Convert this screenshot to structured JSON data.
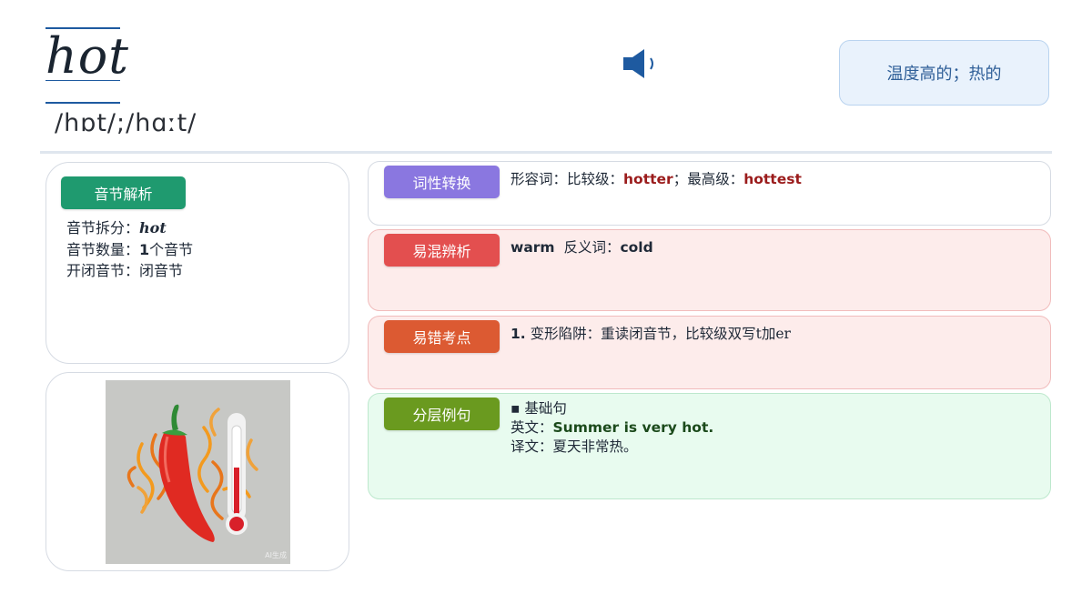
{
  "header": {
    "word": "hot",
    "phonetic": "/hɒt/;/hɑːt/",
    "meaning": "温度高的；热的",
    "speaker_icon": "speaker-icon"
  },
  "syllable": {
    "title": "音节解析",
    "split_label": "音节拆分：",
    "split_value": "hot",
    "count_label": "音节数量：",
    "count_value": "1",
    "count_suffix": "个音节",
    "type_label": "开闭音节：",
    "type_value": "闭音节"
  },
  "illustration": {
    "watermark": "AI生成"
  },
  "pos": {
    "title": "词性转换",
    "adj_label": "形容词：比较级：",
    "comparative": "hotter",
    "sep": "；最高级：",
    "superlative": "hottest"
  },
  "confusion": {
    "title": "易混辨析",
    "word": "warm",
    "antonym_label": "反义词：",
    "antonym": "cold"
  },
  "errors": {
    "title": "易错考点",
    "num": "1.",
    "text": "变形陷阱：重读闭音节，比较级双写t加er"
  },
  "examples": {
    "title": "分层例句",
    "level": "▪ 基础句",
    "en_label": "英文：",
    "en": "Summer is very hot.",
    "zh_label": "译文：",
    "zh": "夏天非常热。"
  },
  "colors": {
    "syllable_pill": "#1f9a6f",
    "pos_pill": "#8a77e0",
    "confusion_pill": "#e34f4f",
    "error_pill": "#dc5a32",
    "example_pill": "#6a9a1f",
    "accent_red": "#9b1c1c",
    "accent_blue": "#1e5aa0"
  }
}
